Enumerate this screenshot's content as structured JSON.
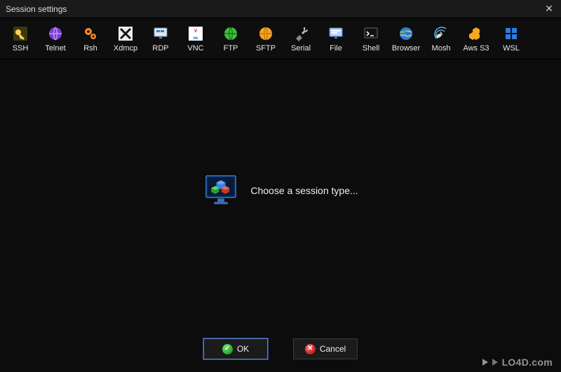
{
  "window": {
    "title": "Session settings",
    "close_glyph": "✕"
  },
  "toolbar": {
    "items": [
      {
        "id": "ssh",
        "label": "SSH"
      },
      {
        "id": "telnet",
        "label": "Telnet"
      },
      {
        "id": "rsh",
        "label": "Rsh"
      },
      {
        "id": "xdmcp",
        "label": "Xdmcp"
      },
      {
        "id": "rdp",
        "label": "RDP"
      },
      {
        "id": "vnc",
        "label": "VNC"
      },
      {
        "id": "ftp",
        "label": "FTP"
      },
      {
        "id": "sftp",
        "label": "SFTP"
      },
      {
        "id": "serial",
        "label": "Serial"
      },
      {
        "id": "file",
        "label": "File"
      },
      {
        "id": "shell",
        "label": "Shell"
      },
      {
        "id": "browser",
        "label": "Browser"
      },
      {
        "id": "mosh",
        "label": "Mosh"
      },
      {
        "id": "awss3",
        "label": "Aws S3"
      },
      {
        "id": "wsl",
        "label": "WSL"
      }
    ]
  },
  "content": {
    "prompt": "Choose a session type..."
  },
  "footer": {
    "ok_label": "OK",
    "cancel_label": "Cancel",
    "ok_glyph": "✓",
    "cancel_glyph": "✕"
  },
  "watermark": {
    "text": "LO4D.com"
  }
}
